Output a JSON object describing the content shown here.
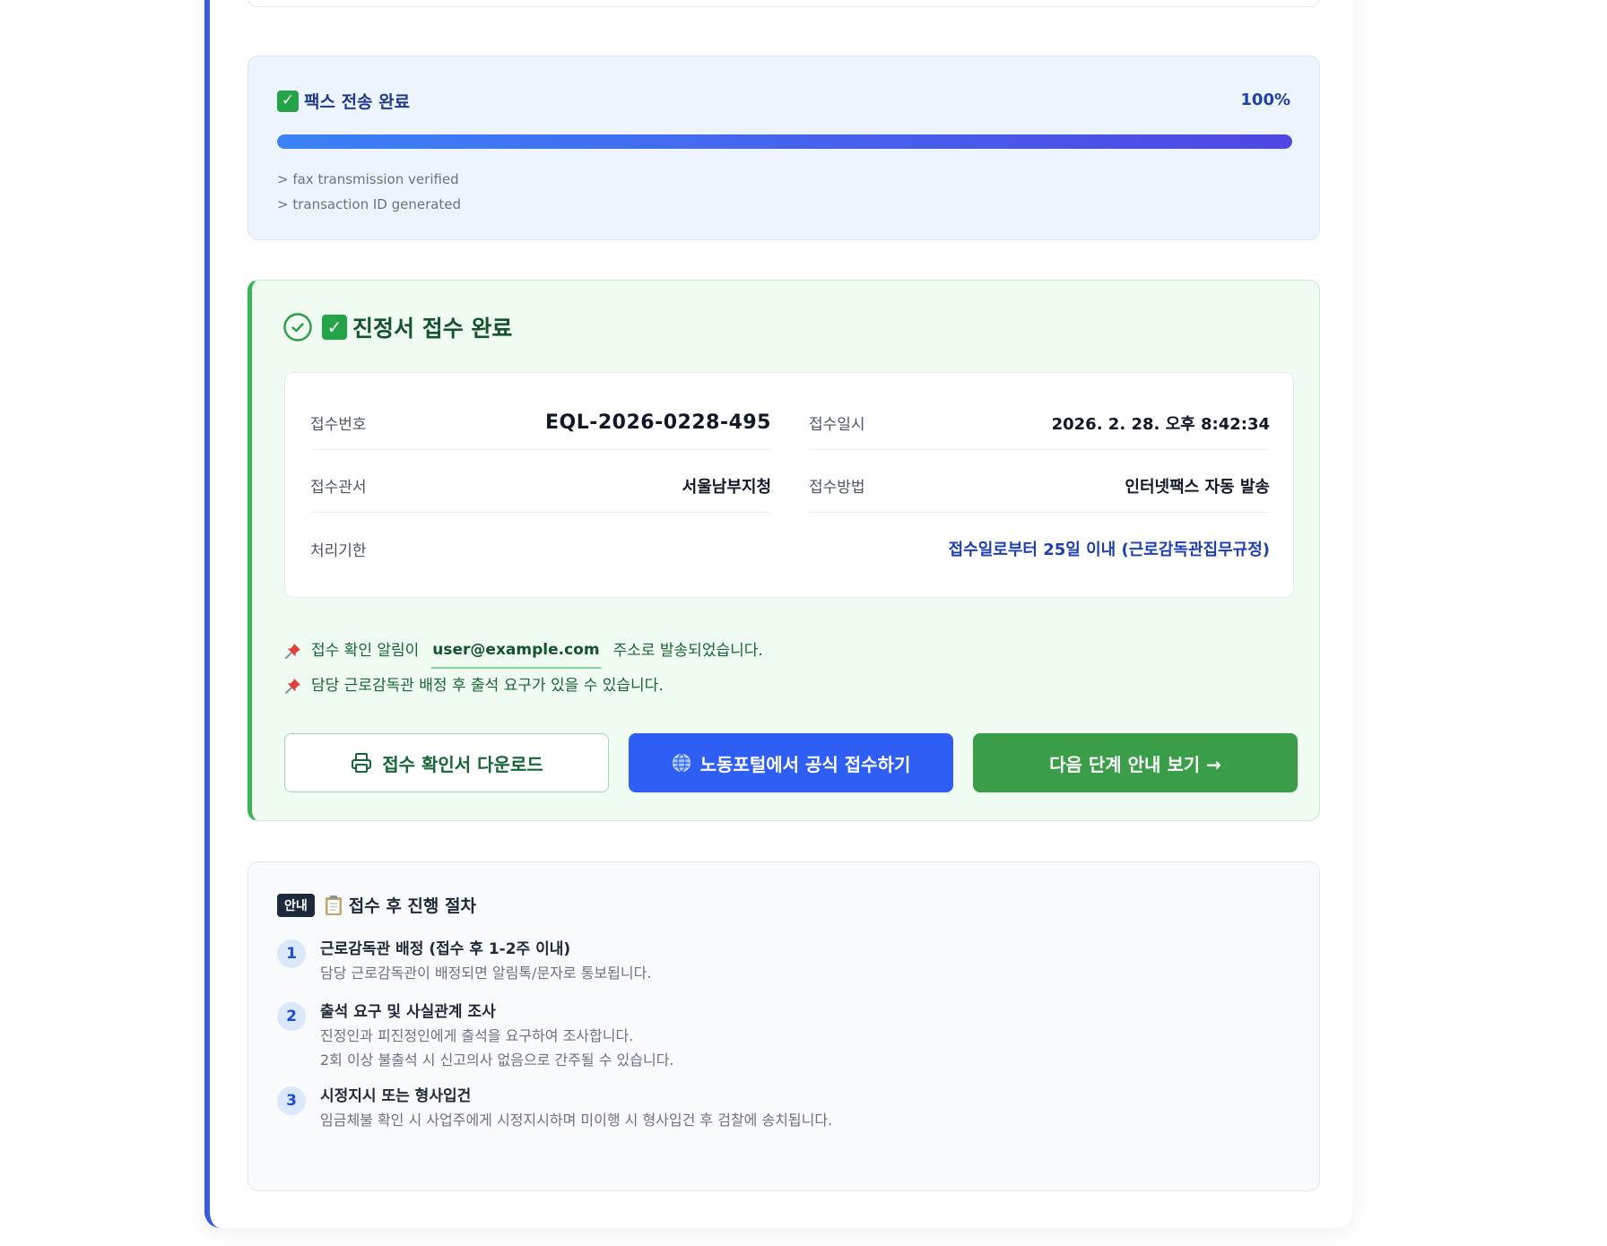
{
  "progress": {
    "title": "팩스 전송 완료",
    "percent_label": "100%",
    "percent_value": 100,
    "log": [
      "> fax transmission verified",
      "> transaction ID generated"
    ]
  },
  "receipt": {
    "title": "진정서 접수 완료",
    "fields": {
      "number_label": "접수번호",
      "number_value": "EQL-2026-0228-495",
      "datetime_label": "접수일시",
      "datetime_value": "2026. 2. 28. 오후 8:42:34",
      "office_label": "접수관서",
      "office_value": "서울남부지청",
      "method_label": "접수방법",
      "method_value": "인터넷팩스 자동 발송",
      "deadline_label": "처리기한",
      "deadline_value": "접수일로부터 25일 이내 (근로감독관집무규정)"
    },
    "notes": {
      "email_prefix": "접수 확인 알림이",
      "email": "user@example.com",
      "email_suffix": "주소로 발송되었습니다.",
      "second": "담당 근로감독관 배정 후 출석 요구가 있을 수 있습니다."
    },
    "buttons": {
      "download": "접수 확인서 다운로드",
      "portal": "노동포털에서 공식 접수하기",
      "next": "다음 단계 안내 보기 →"
    }
  },
  "steps": {
    "badge": "안내",
    "title": "접수 후 진행 절차",
    "items": [
      {
        "num": "1",
        "title": "근로감독관 배정 (접수 후 1-2주 이내)",
        "desc": [
          "담당 근로감독관이 배정되면 알림톡/문자로 통보됩니다."
        ]
      },
      {
        "num": "2",
        "title": "출석 요구 및 사실관계 조사",
        "desc": [
          "진정인과 피진정인에게 출석을 요구하여 조사합니다.",
          "2회 이상 불출석 시 신고의사 없음으로 간주될 수 있습니다."
        ]
      },
      {
        "num": "3",
        "title": "시정지시 또는 형사입건",
        "desc": [
          "임금체불 확인 시 사업주에게 시정지시하며 미이행 시 형사입건 후 검찰에 송치됩니다."
        ]
      }
    ]
  },
  "colors": {
    "accent_blue": "#2f5ef5",
    "success_green": "#3a9d48",
    "shell_border": "#3b5bdb"
  }
}
